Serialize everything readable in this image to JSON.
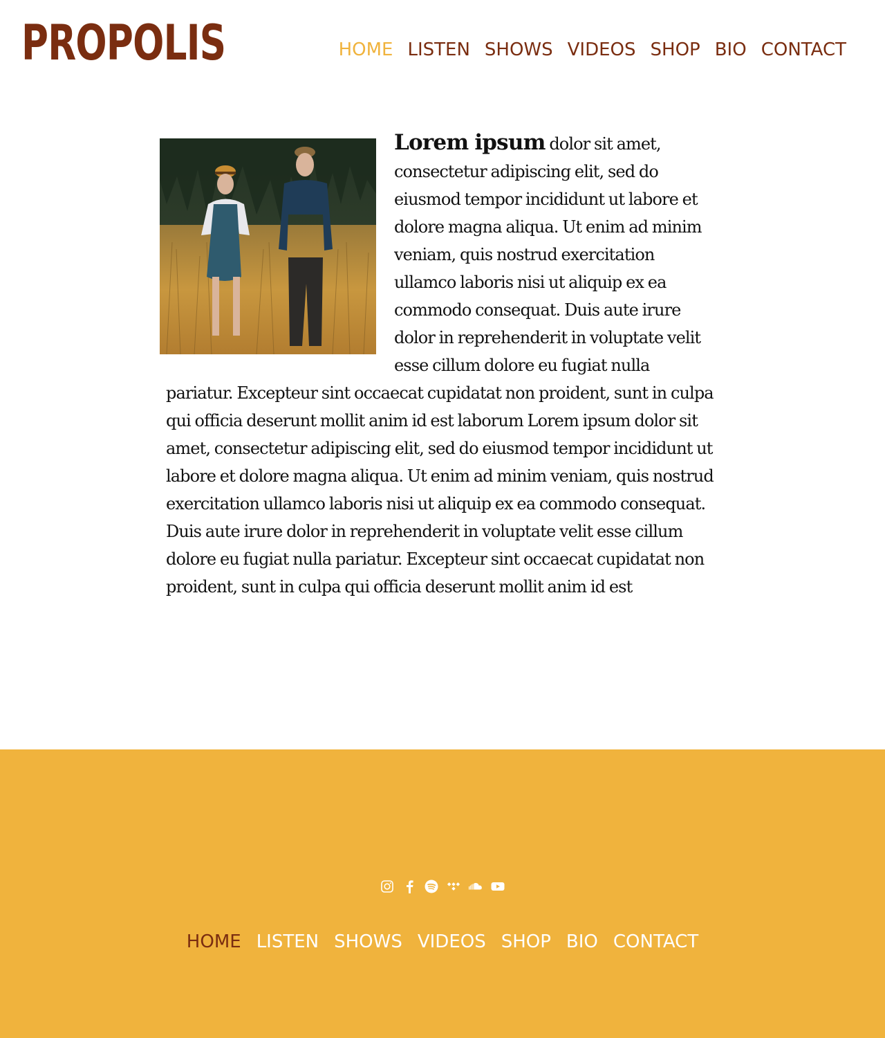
{
  "site": {
    "logo_text": "PROPOLIS"
  },
  "nav": {
    "items": [
      {
        "label": "HOME",
        "active": true
      },
      {
        "label": "LISTEN",
        "active": false
      },
      {
        "label": "SHOWS",
        "active": false
      },
      {
        "label": "VIDEOS",
        "active": false
      },
      {
        "label": "SHOP",
        "active": false
      },
      {
        "label": "BIO",
        "active": false
      },
      {
        "label": "CONTACT",
        "active": false
      }
    ]
  },
  "article": {
    "lead": "Lorem ipsum",
    "body": "dolor sit amet, consectetur adipiscing elit, sed do eiusmod tempor incididunt ut labore et dolore magna aliqua. Ut enim ad minim veniam, quis nostrud exercitation ullamco laboris nisi ut aliquip ex ea commodo consequat. Duis aute irure dolor in reprehenderit in voluptate velit esse cillum dolore eu fugiat nulla pariatur. Excepteur sint occaecat cupidatat non proident, sunt in culpa qui officia deserunt mollit anim id est laborum Lorem ipsum dolor sit amet, consectetur adipiscing elit, sed do eiusmod tempor incididunt ut labore et dolore magna aliqua. Ut enim ad minim veniam, quis nostrud exercitation ullamco laboris nisi ut aliquip ex ea commodo consequat. Duis aute irure dolor in reprehenderit in voluptate velit esse cillum dolore eu fugiat nulla pariatur. Excepteur sint occaecat cupidatat non proident, sunt in culpa qui officia deserunt mollit anim id est",
    "photo_icon": "band-photo-two-people-in-field"
  },
  "footer": {
    "social_icons": [
      "instagram-icon",
      "facebook-icon",
      "spotify-icon",
      "tidal-icon",
      "soundcloud-icon",
      "youtube-icon"
    ]
  },
  "colors": {
    "brand": "#7a2d10",
    "accent": "#f0b33d",
    "footer_bg": "#f0b33d",
    "footer_text": "#ffffff"
  }
}
